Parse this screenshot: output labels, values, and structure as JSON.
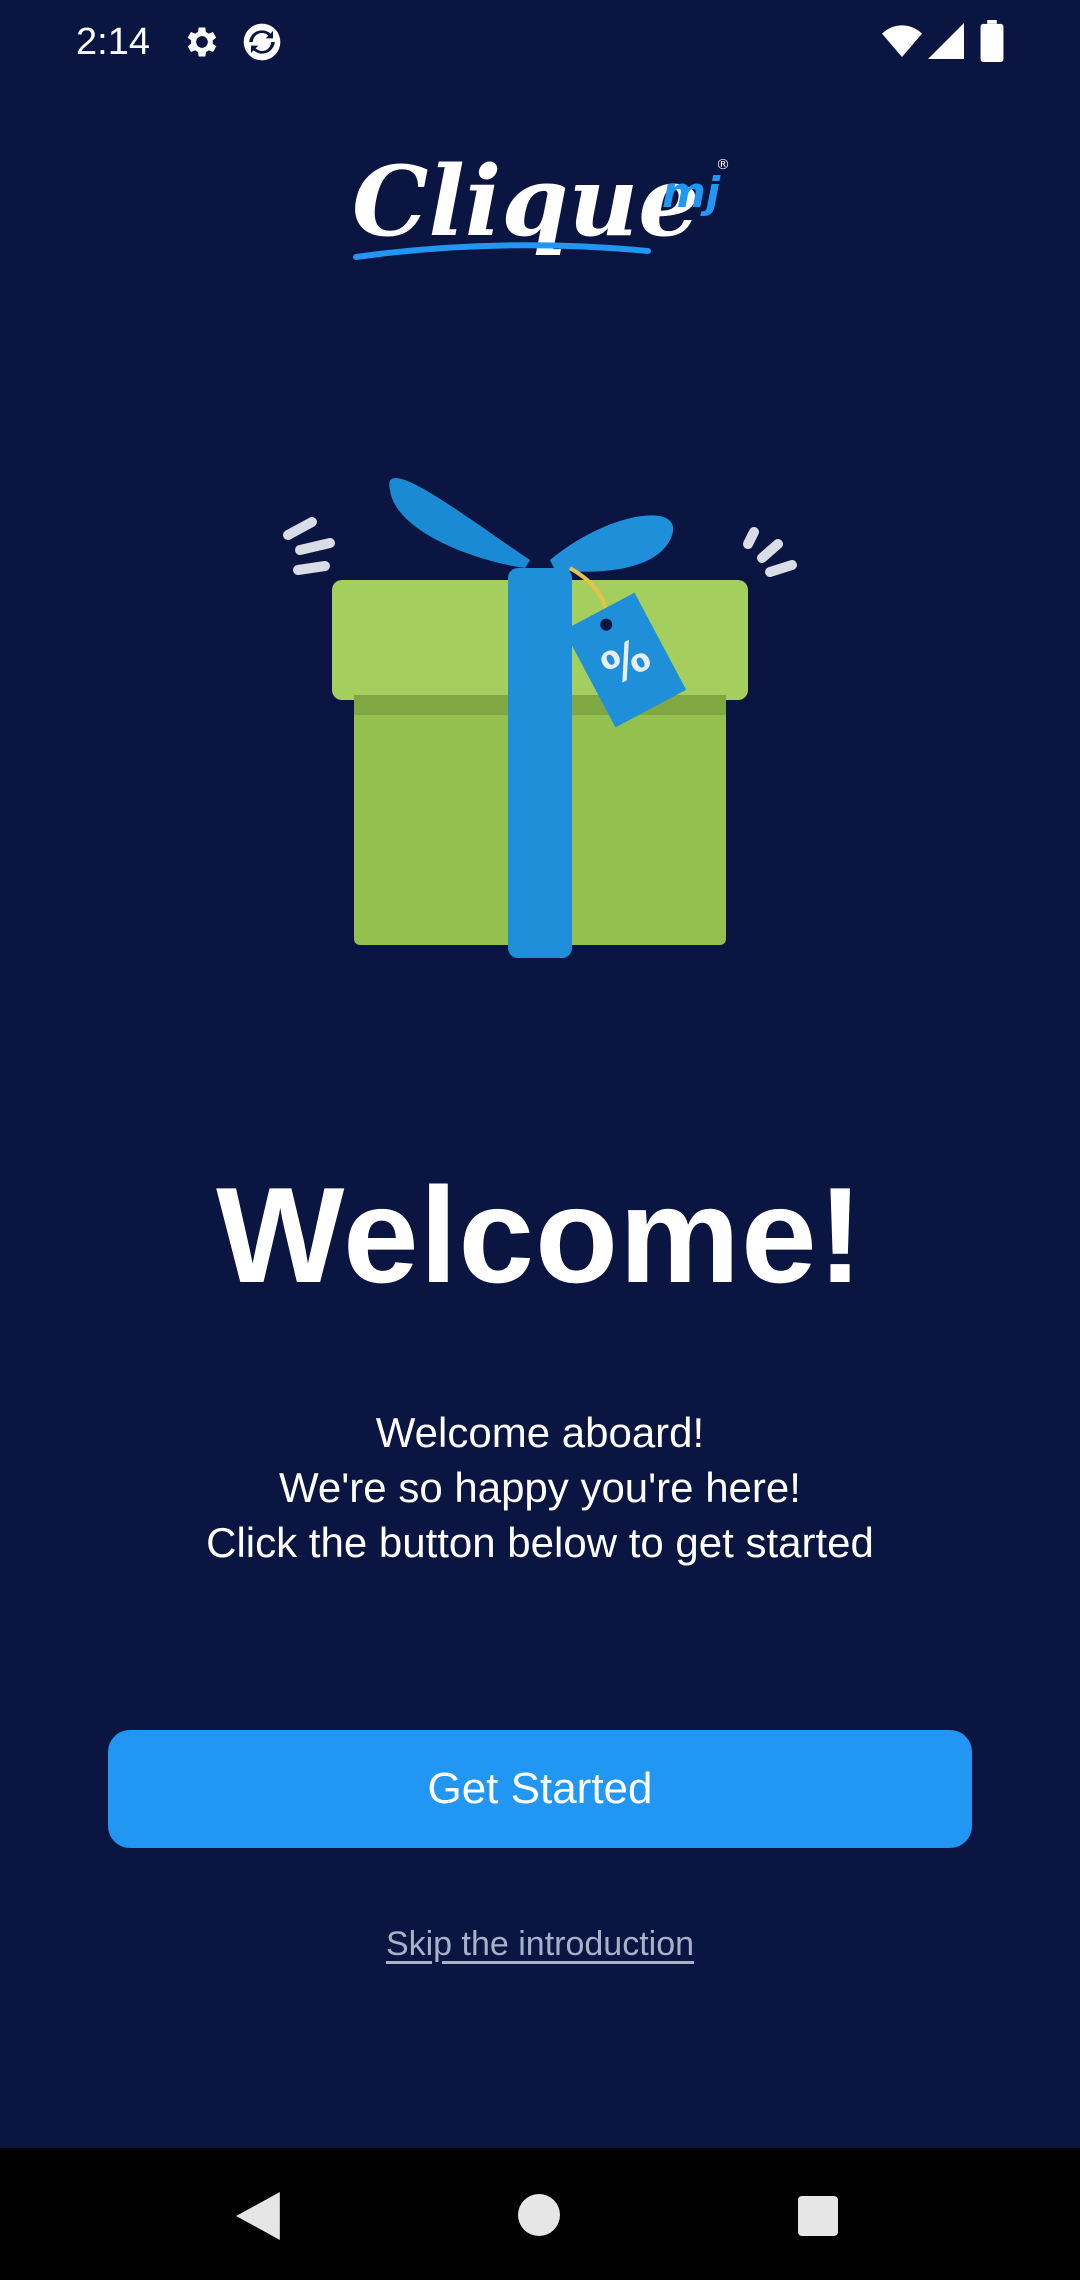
{
  "status_bar": {
    "time": "2:14",
    "icons": [
      "settings-gear-icon",
      "sync-icon",
      "wifi-icon",
      "cell-signal-icon",
      "battery-icon"
    ]
  },
  "logo": {
    "brand": "Clique",
    "suffix": "mj",
    "registered": "®"
  },
  "illustration": {
    "icon": "gift-box-icon",
    "tag_text": "%"
  },
  "welcome": {
    "title": "Welcome!",
    "lines": [
      "Welcome aboard!",
      "We're so happy you're here!",
      "Click the button below to get started"
    ]
  },
  "actions": {
    "get_started": "Get Started",
    "skip": "Skip the introduction"
  },
  "colors": {
    "background": "#0b1541",
    "accent": "#2196f3",
    "gift_green": "#9cc85a",
    "ribbon_blue": "#1e8fd8"
  },
  "nav_bar": {
    "icons": [
      "back-icon",
      "home-icon",
      "recents-icon"
    ]
  }
}
